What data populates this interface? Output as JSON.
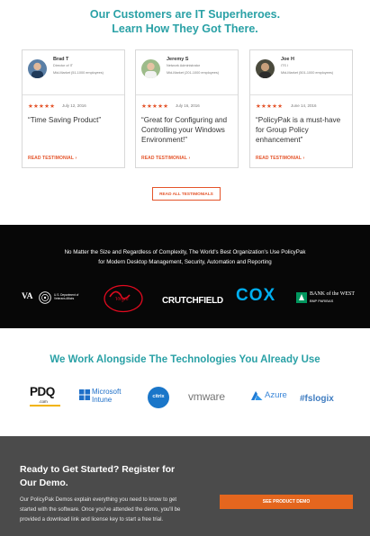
{
  "header": {
    "line1": "Our Customers are IT Superheroes.",
    "line2": "Learn How They Got There."
  },
  "testimonials": [
    {
      "name": "Brad T",
      "title": "Director of IT",
      "company": "Mid-Market (51-1000 employees)",
      "stars": "★★★★★",
      "date": "July 12, 2016",
      "quote": "“Time Saving Product”",
      "link": "READ TESTIMONIAL ›"
    },
    {
      "name": "Jeremy S",
      "title": "Network Administrator",
      "company": "Mid-Market (201-1000 employees)",
      "stars": "★★★★★",
      "date": "July 16, 2016",
      "quote": "“Great for Configuring and Controlling your Windows Environment!”",
      "link": "READ TESTIMONIAL ›"
    },
    {
      "name": "Joe H",
      "title": "ITS I",
      "company": "Mid-Market (501-1000 employees)",
      "stars": "★★★★★",
      "date": "June 14, 2016",
      "quote": "“PolicyPak is a must-have for Group Policy enhancement”",
      "link": "READ TESTIMONIAL ›"
    }
  ],
  "read_all_label": "READ ALL TESTIMONIALS",
  "customers": {
    "line1": "No Matter the Size and Regardless of Complexity, The World's Best Organization's Use PolicyPak",
    "line2": "for Modern Desktop Management, Security, Automation and Reporting",
    "logos": {
      "va": "VA",
      "va_sub": "U.S. Department of Veterans Affairs",
      "virgin": "Virgin",
      "crutchfield": "CRUTCHFIELD",
      "cox": "COX",
      "bank_line1": "BANK of the WEST",
      "bank_line2": "BNP PARIBAS"
    }
  },
  "tech": {
    "title": "We Work Alongside The Technologies You Already Use",
    "logos": {
      "pdq": "PDQ",
      "pdq_sub": ".com",
      "intune1": "Microsoft",
      "intune2": "Intune",
      "citrix": "citrix",
      "vmware": "vmware",
      "azure": "Azure",
      "fslogix": "#fslogix"
    }
  },
  "cta": {
    "title": "Ready to Get Started? Register for Our Demo.",
    "body": "Our PolicyPak Demos explain everything you need to know to get started with the software. Once you've attended the demo, you'll be provided a download link and license key to start a free trial.",
    "button": "SEE PRODUCT DEMO"
  },
  "colors": {
    "teal": "#2aa1a6",
    "orange": "#e4542a",
    "dark": "#070707",
    "cta_bg": "#4b4b4b"
  }
}
